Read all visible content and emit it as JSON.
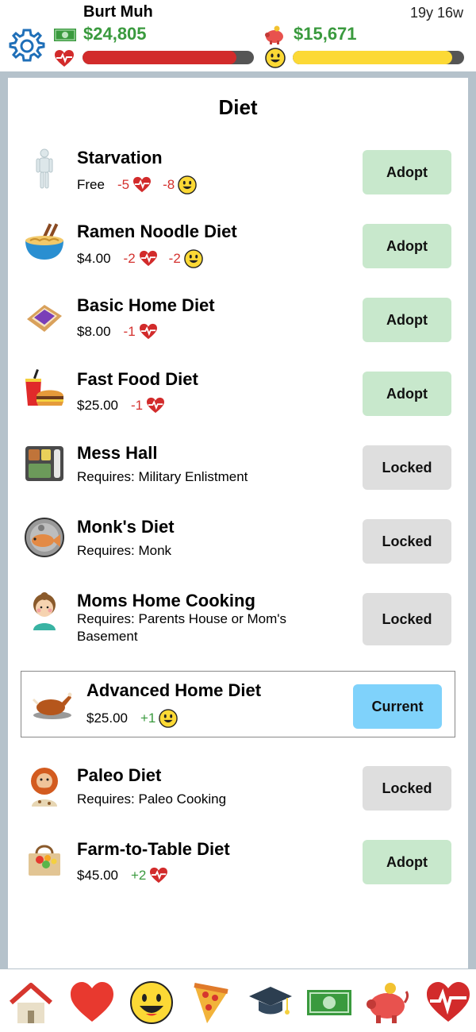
{
  "player": {
    "name": "Burt Muh",
    "age": "19y 16w",
    "cash": "$24,805",
    "savings": "$15,671",
    "health_level": 0.9,
    "happiness_level": 0.93
  },
  "colors": {
    "money_green": "#3a9a3e",
    "health_red": "#d22b2b",
    "happy_yellow": "#fcd935",
    "adopt_bg": "#c8e8cc",
    "locked_bg": "#dedede",
    "current_bg": "#7fd2fb",
    "frame": "#b5c2cb"
  },
  "page": {
    "title": "Diet"
  },
  "diets": [
    {
      "name": "Starvation",
      "price": "Free",
      "health": "-5",
      "happiness": "-8",
      "button": "Adopt",
      "icon": "skeleton-icon"
    },
    {
      "name": "Ramen Noodle Diet",
      "price": "$4.00",
      "health": "-2",
      "happiness": "-2",
      "button": "Adopt",
      "icon": "ramen-bowl-icon"
    },
    {
      "name": "Basic Home Diet",
      "price": "$8.00",
      "health": "-1",
      "button": "Adopt",
      "icon": "toast-jam-icon"
    },
    {
      "name": "Fast Food Diet",
      "price": "$25.00",
      "health": "-1",
      "button": "Adopt",
      "icon": "burger-soda-icon"
    },
    {
      "name": "Mess Hall",
      "requirement": "Requires: Military Enlistment",
      "button": "Locked",
      "icon": "meal-tray-icon"
    },
    {
      "name": "Monk's Diet",
      "requirement": "Requires: Monk",
      "button": "Locked",
      "icon": "fish-plate-icon"
    },
    {
      "name": "Moms Home Cooking",
      "requirement": "Requires: Parents House or Mom's Basement",
      "button": "Locked",
      "icon": "mom-icon"
    },
    {
      "name": "Advanced Home Diet",
      "price": "$25.00",
      "happiness": "+1",
      "button": "Current",
      "icon": "roast-chicken-icon"
    },
    {
      "name": "Paleo Diet",
      "requirement": "Requires: Paleo Cooking",
      "button": "Locked",
      "icon": "caveman-icon"
    },
    {
      "name": "Farm-to-Table Diet",
      "price": "$45.00",
      "health": "+2",
      "button": "Adopt",
      "icon": "produce-basket-icon"
    }
  ],
  "nav": [
    "home-icon",
    "heart-icon",
    "smiley-icon",
    "pizza-icon",
    "graduation-cap-icon",
    "money-icon",
    "piggy-bank-icon",
    "health-pulse-icon"
  ]
}
